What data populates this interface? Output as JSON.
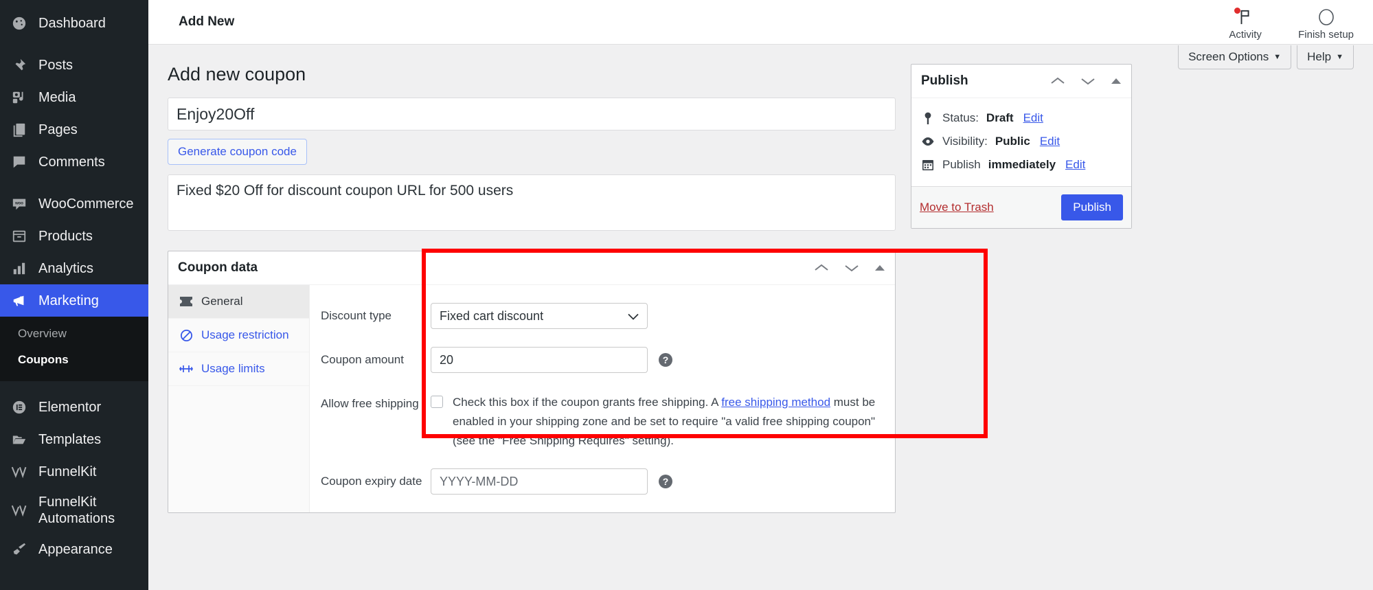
{
  "sidebar": {
    "items": [
      {
        "label": "Dashboard",
        "icon": "dashboard-icon"
      },
      {
        "label": "Posts",
        "icon": "pin-icon"
      },
      {
        "label": "Media",
        "icon": "media-icon"
      },
      {
        "label": "Pages",
        "icon": "pages-icon"
      },
      {
        "label": "Comments",
        "icon": "comments-icon"
      },
      {
        "label": "WooCommerce",
        "icon": "woocommerce-icon"
      },
      {
        "label": "Products",
        "icon": "products-icon"
      },
      {
        "label": "Analytics",
        "icon": "analytics-icon"
      },
      {
        "label": "Marketing",
        "icon": "megaphone-icon"
      },
      {
        "label": "Elementor",
        "icon": "elementor-icon"
      },
      {
        "label": "Templates",
        "icon": "folder-icon"
      },
      {
        "label": "FunnelKit",
        "icon": "funnelkit-icon"
      },
      {
        "label": "FunnelKit\nAutomations",
        "icon": "funnelkit-icon"
      },
      {
        "label": "Appearance",
        "icon": "brush-icon"
      }
    ],
    "submenu": [
      {
        "label": "Overview",
        "active": false
      },
      {
        "label": "Coupons",
        "active": true
      }
    ]
  },
  "adminbar": {
    "title": "Add New",
    "activity_label": "Activity",
    "finish_setup_label": "Finish setup"
  },
  "screen_meta": {
    "screen_options": "Screen Options",
    "help": "Help",
    "caret": "▼"
  },
  "page": {
    "title": "Add new coupon",
    "coupon_code_value": "Enjoy20Off",
    "generate_button": "Generate coupon code",
    "description_value": "Fixed $20 Off for discount coupon URL for 500 users"
  },
  "coupon_data": {
    "panel_title": "Coupon data",
    "tabs": [
      {
        "label": "General",
        "icon": "ticket-icon",
        "active": true
      },
      {
        "label": "Usage restriction",
        "icon": "block-icon",
        "active": false
      },
      {
        "label": "Usage limits",
        "icon": "limits-icon",
        "active": false
      }
    ],
    "fields": {
      "discount_type_label": "Discount type",
      "discount_type_value": "Fixed cart discount",
      "coupon_amount_label": "Coupon amount",
      "coupon_amount_value": "20",
      "free_shipping_label": "Allow free shipping",
      "free_shipping_text_1": "Check this box if the coupon grants free shipping. A ",
      "free_shipping_link": "free shipping method",
      "free_shipping_text_2": " must be enabled in your shipping zone and be set to require \"a valid free shipping coupon\" (see the \"Free Shipping Requires\" setting).",
      "free_shipping_checked": false,
      "expiry_label": "Coupon expiry date",
      "expiry_placeholder": "YYYY-MM-DD",
      "expiry_value": ""
    }
  },
  "publish": {
    "title": "Publish",
    "status_label": "Status:",
    "status_value": "Draft",
    "status_edit": "Edit",
    "visibility_label": "Visibility:",
    "visibility_value": "Public",
    "visibility_edit": "Edit",
    "schedule_label": "Publish",
    "schedule_value": "immediately",
    "schedule_edit": "Edit",
    "trash_label": "Move to Trash",
    "publish_button": "Publish"
  },
  "annotation": {
    "highlight_color": "#fe0000",
    "arrow_color": "#fe0000"
  },
  "colors": {
    "accent": "#3858e9",
    "sidebar_bg": "#1d2327",
    "page_bg": "#f0f0f1"
  }
}
